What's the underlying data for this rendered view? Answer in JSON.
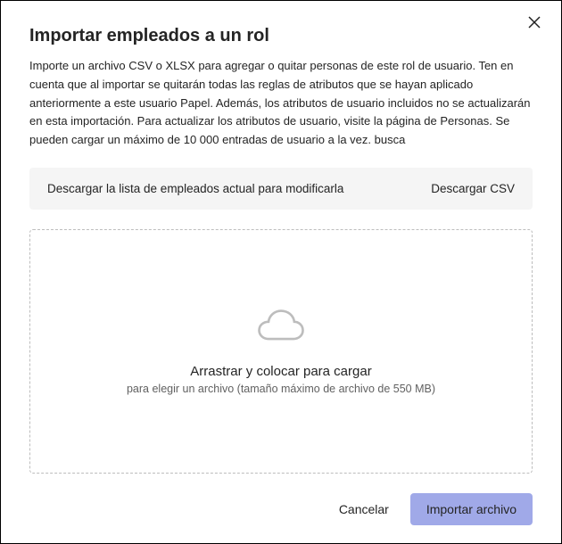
{
  "dialog": {
    "title": "Importar empleados a un rol",
    "description": "Importe un archivo CSV o XLSX para agregar o quitar personas de este rol de usuario.       Ten en cuenta que al importar se quitarán todas las reglas de atributos que se hayan aplicado anteriormente a este usuario Papel. Además, los atributos de usuario incluidos no se actualizarán en esta importación. Para actualizar los atributos de usuario, visite la página de Personas. Se pueden cargar un máximo de 10 000 entradas de usuario a la vez. busca"
  },
  "download": {
    "label": "Descargar la lista de empleados actual para modificarla",
    "action": "Descargar CSV"
  },
  "dropzone": {
    "title": "Arrastrar y colocar para cargar",
    "subtitle": "para elegir un archivo (tamaño máximo de archivo de 550 MB)"
  },
  "footer": {
    "cancel": "Cancelar",
    "import": "Importar archivo"
  }
}
